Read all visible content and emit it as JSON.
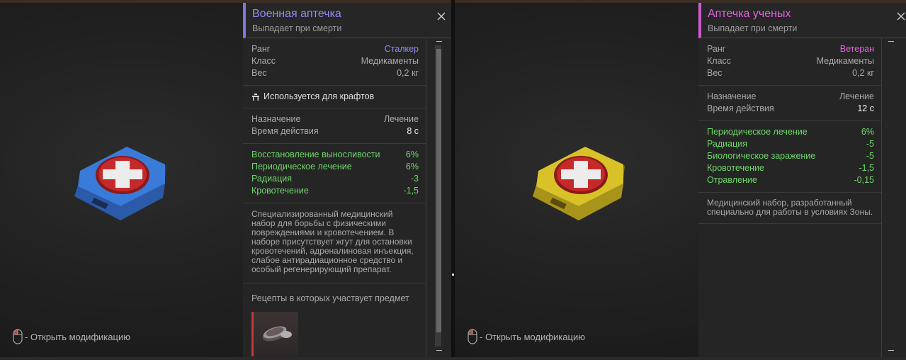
{
  "left": {
    "title": "Военная аптечка",
    "subtitle": "Выпадает при смерти",
    "stats": [
      {
        "label": "Ранг",
        "value": "Сталкер"
      },
      {
        "label": "Класс",
        "value": "Медикаменты"
      },
      {
        "label": "Вес",
        "value": "0,2 кг"
      }
    ],
    "craft_label": "Используется для крафтов",
    "usage": [
      {
        "label": "Назначение",
        "value": "Лечение"
      },
      {
        "label": "Время действия",
        "value": "8 с"
      }
    ],
    "effects": [
      {
        "label": "Восстановление выносливости",
        "value": "6%"
      },
      {
        "label": "Периодическое лечение",
        "value": "6%"
      },
      {
        "label": "Радиация",
        "value": "-3"
      },
      {
        "label": "Кровотечение",
        "value": "-1,5"
      }
    ],
    "description": "Специализированный медицинский набор для борьбы с физическими повреждениями и кровотечением. В наборе присутствует жгут для остановки кровотечений, адреналиновая инъекция, слабое антирадиационное средство и особый регенерирующий препарат.",
    "recipes_label": "Рецепты в которых участвует предмет",
    "hint": "- Открыть модификацию",
    "color": "#3a7ad8"
  },
  "right": {
    "title": "Аптечка ученых",
    "subtitle": "Выпадает при смерти",
    "stats": [
      {
        "label": "Ранг",
        "value": "Ветеран"
      },
      {
        "label": "Класс",
        "value": "Медикаменты"
      },
      {
        "label": "Вес",
        "value": "0,2 кг"
      }
    ],
    "usage": [
      {
        "label": "Назначение",
        "value": "Лечение"
      },
      {
        "label": "Время действия",
        "value": "12 с"
      }
    ],
    "effects": [
      {
        "label": "Периодическое лечение",
        "value": "6%"
      },
      {
        "label": "Радиация",
        "value": "-5"
      },
      {
        "label": "Биологическое заражение",
        "value": "-5"
      },
      {
        "label": "Кровотечение",
        "value": "-1,5"
      },
      {
        "label": "Отравление",
        "value": "-0,15"
      }
    ],
    "description": "Медицинский набор, разработанный специально для работы в условиях Зоны.",
    "hint": "- Открыть модификацию",
    "color": "#d8c227"
  },
  "colors": {
    "rank_stalker": "#8f8cf5",
    "rank_veteran": "#dd66d8",
    "effect_green": "#6fd66a"
  },
  "icons": {
    "close": "close-icon",
    "mouse": "mouse-icon",
    "craft": "workbench-icon"
  }
}
